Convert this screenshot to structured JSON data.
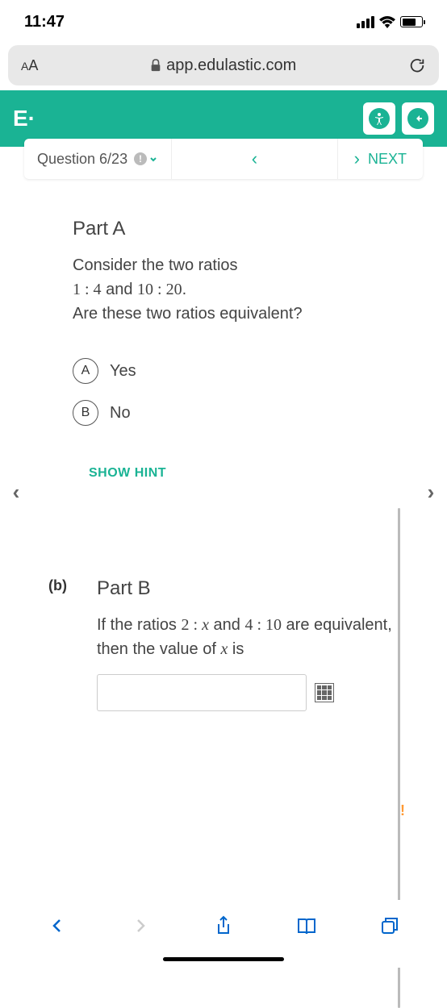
{
  "status_bar": {
    "time": "11:47"
  },
  "url_bar": {
    "text_size": "AA",
    "domain": "app.edulastic.com"
  },
  "header": {
    "logo": "E·"
  },
  "nav": {
    "question_label": "Question 6/23",
    "next_label": "NEXT"
  },
  "partA": {
    "title": "Part A",
    "text_line1": "Consider the two ratios",
    "ratio1": "1 : 4",
    "and": " and ",
    "ratio2": "10 : 20",
    "period": ".",
    "text_line2": "Are these two ratios equivalent?",
    "options": [
      {
        "letter": "A",
        "text": "Yes"
      },
      {
        "letter": "B",
        "text": "No"
      }
    ],
    "hint_label": "SHOW HINT"
  },
  "partB": {
    "label": "(b)",
    "title": "Part B",
    "text_prefix": "If the ratios ",
    "ratio1": "2 : ",
    "var1": "x",
    "text_mid1": " and ",
    "ratio2": "4 : 10",
    "text_mid2": " are equivalent, then the value of ",
    "var2": "x",
    "text_suffix": " is"
  }
}
